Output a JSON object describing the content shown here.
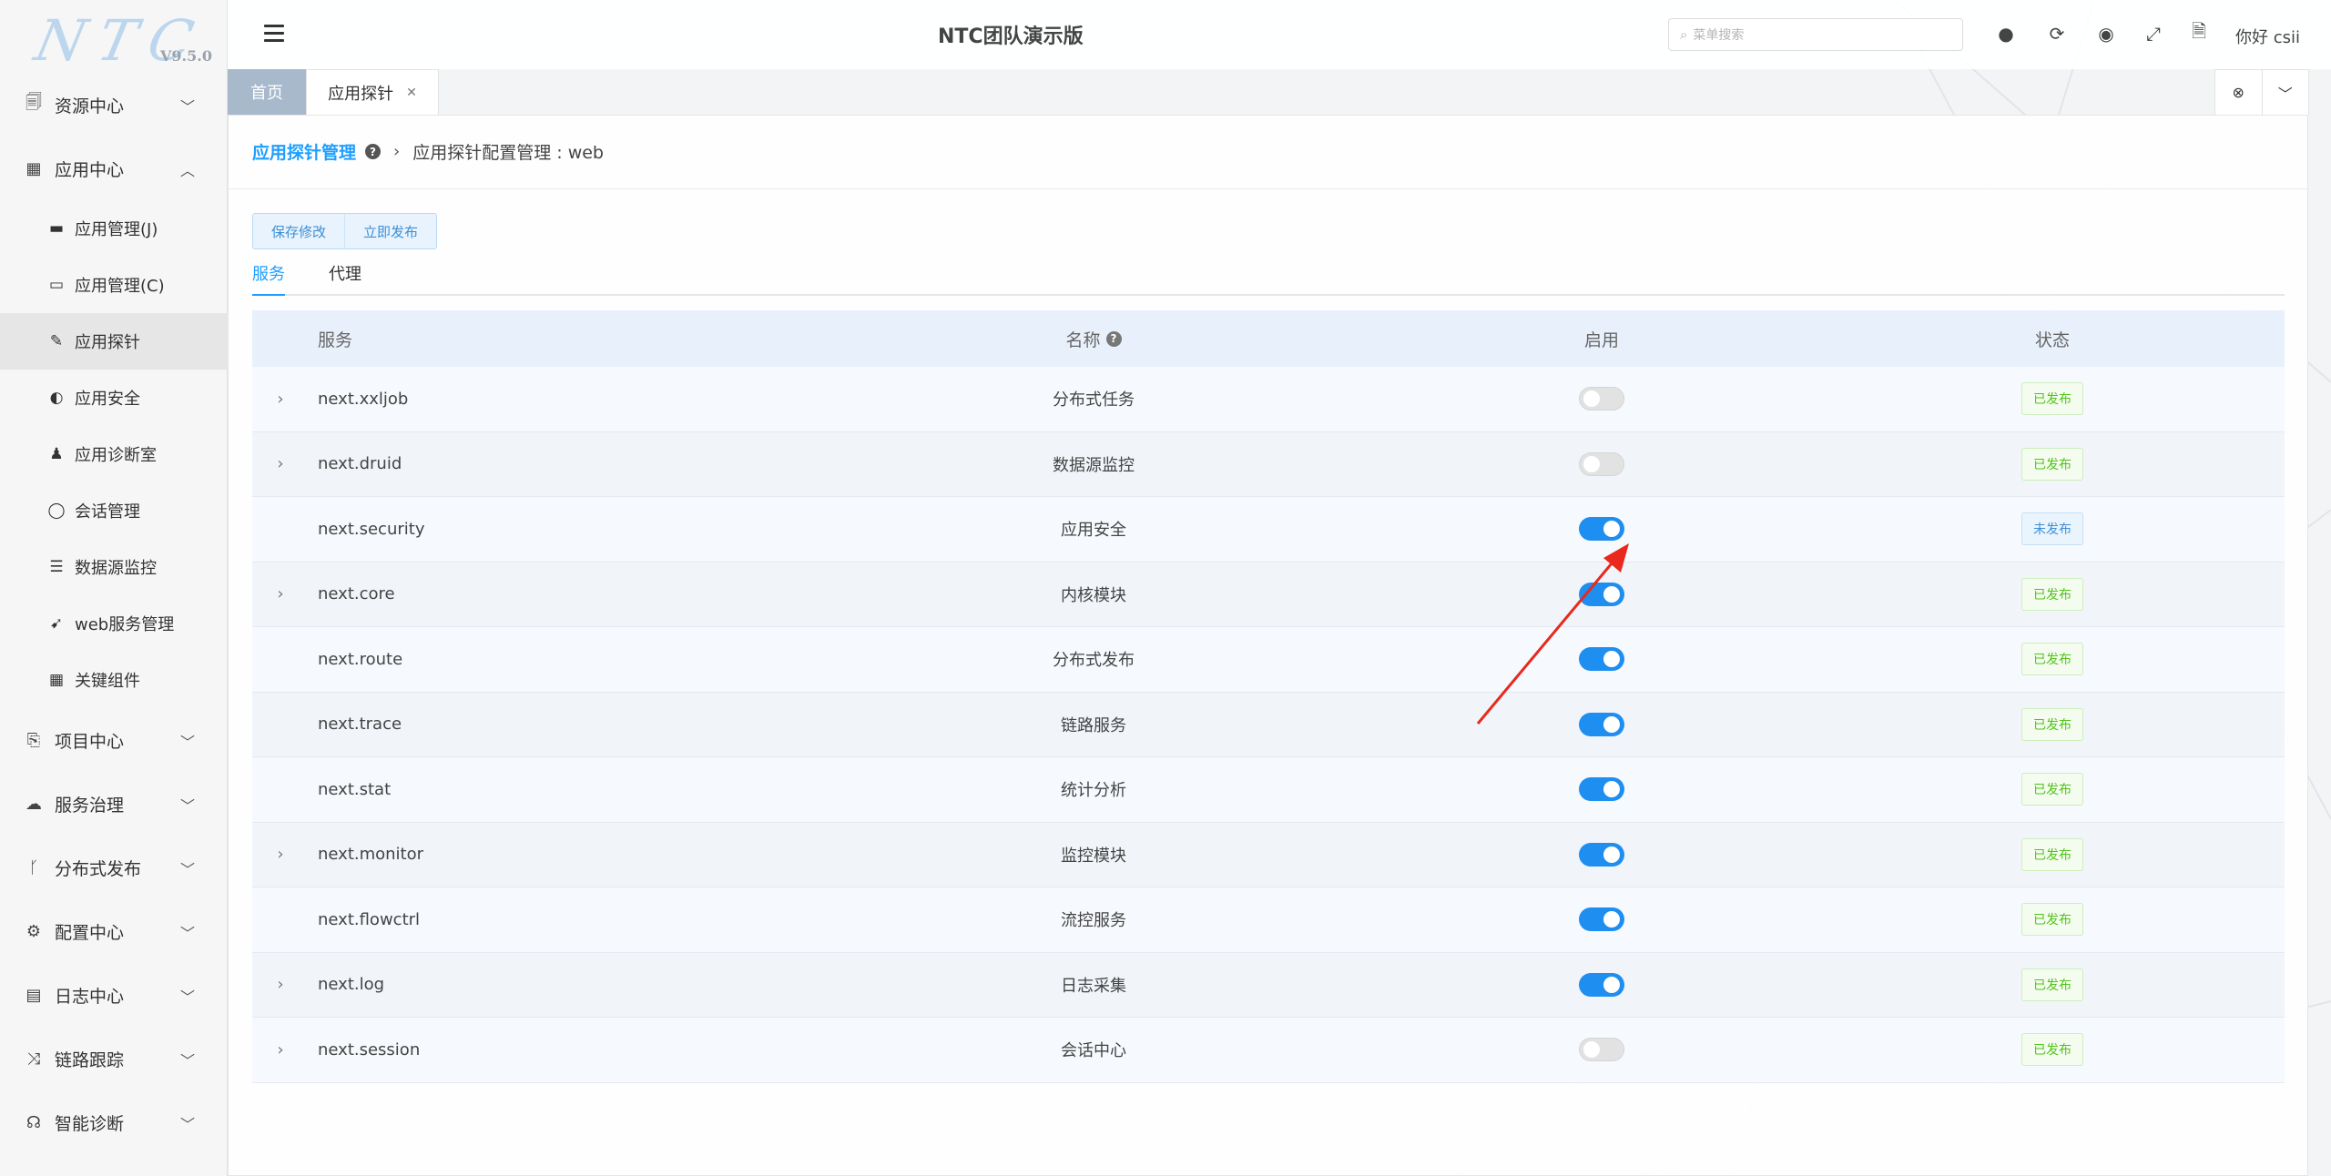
{
  "logo": {
    "text": "NTC",
    "version": "V9.5.0"
  },
  "sidebar": {
    "groups": [
      {
        "label": "资源中心",
        "icon": "resource-icon",
        "expanded": false
      },
      {
        "label": "应用中心",
        "icon": "app-center-icon",
        "expanded": true,
        "items": [
          {
            "label": "应用管理(J)",
            "icon": "folder-solid-icon"
          },
          {
            "label": "应用管理(C)",
            "icon": "folder-outline-icon"
          },
          {
            "label": "应用探针",
            "icon": "probe-icon",
            "active": true
          },
          {
            "label": "应用安全",
            "icon": "shield-icon"
          },
          {
            "label": "应用诊断室",
            "icon": "doctor-icon"
          },
          {
            "label": "会话管理",
            "icon": "user-circle-icon"
          },
          {
            "label": "数据源监控",
            "icon": "database-icon"
          },
          {
            "label": "web服务管理",
            "icon": "send-icon"
          },
          {
            "label": "关键组件",
            "icon": "grid-icon"
          }
        ]
      },
      {
        "label": "项目中心",
        "icon": "project-icon",
        "expanded": false
      },
      {
        "label": "服务治理",
        "icon": "service-icon",
        "expanded": false
      },
      {
        "label": "分布式发布",
        "icon": "branch-icon",
        "expanded": false
      },
      {
        "label": "配置中心",
        "icon": "gears-icon",
        "expanded": false
      },
      {
        "label": "日志中心",
        "icon": "log-icon",
        "expanded": false
      },
      {
        "label": "链路跟踪",
        "icon": "shuffle-icon",
        "expanded": false
      },
      {
        "label": "智能诊断",
        "icon": "stethoscope-icon",
        "expanded": false
      }
    ]
  },
  "header": {
    "title": "NTC团队演示版",
    "search_placeholder": "菜单搜索",
    "greeting": "你好 csii"
  },
  "tabs": {
    "home": "首页",
    "current": "应用探针"
  },
  "breadcrumb": {
    "root": "应用探针管理",
    "current": "应用探针配置管理 : web"
  },
  "toolbar": {
    "save": "保存修改",
    "publish": "立即发布"
  },
  "subtabs": {
    "service": "服务",
    "proxy": "代理"
  },
  "table": {
    "headers": {
      "service": "服务",
      "name": "名称",
      "enabled": "启用",
      "status": "状态"
    },
    "rows": [
      {
        "service": "next.xxljob",
        "name": "分布式任务",
        "enabled": false,
        "status": "已发布",
        "expandable": true
      },
      {
        "service": "next.druid",
        "name": "数据源监控",
        "enabled": false,
        "status": "已发布",
        "expandable": true
      },
      {
        "service": "next.security",
        "name": "应用安全",
        "enabled": true,
        "status": "未发布",
        "expandable": false
      },
      {
        "service": "next.core",
        "name": "内核模块",
        "enabled": true,
        "status": "已发布",
        "expandable": true
      },
      {
        "service": "next.route",
        "name": "分布式发布",
        "enabled": true,
        "status": "已发布",
        "expandable": false
      },
      {
        "service": "next.trace",
        "name": "链路服务",
        "enabled": true,
        "status": "已发布",
        "expandable": false
      },
      {
        "service": "next.stat",
        "name": "统计分析",
        "enabled": true,
        "status": "已发布",
        "expandable": false
      },
      {
        "service": "next.monitor",
        "name": "监控模块",
        "enabled": true,
        "status": "已发布",
        "expandable": true
      },
      {
        "service": "next.flowctrl",
        "name": "流控服务",
        "enabled": true,
        "status": "已发布",
        "expandable": false
      },
      {
        "service": "next.log",
        "name": "日志采集",
        "enabled": true,
        "status": "已发布",
        "expandable": true
      },
      {
        "service": "next.session",
        "name": "会话中心",
        "enabled": false,
        "status": "已发布",
        "expandable": true
      }
    ]
  },
  "colors": {
    "accent": "#1e9fff",
    "switch_on": "#1e8ef0",
    "published": "#52c41a",
    "annotation": "#e8291c"
  }
}
